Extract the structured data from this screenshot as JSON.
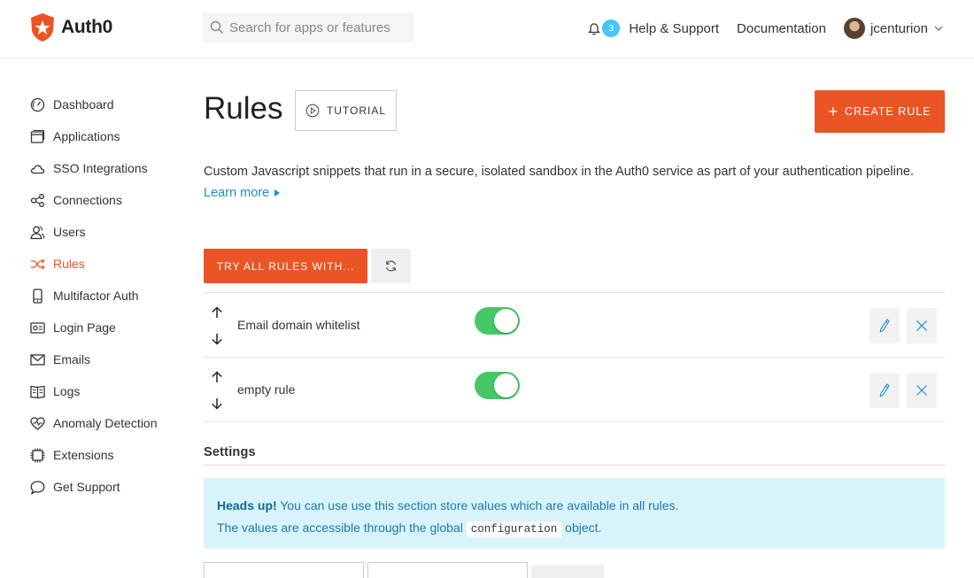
{
  "brand": {
    "name": "Auth0",
    "accent": "#eb5424"
  },
  "search": {
    "placeholder": "Search for apps or features"
  },
  "header": {
    "notifications_count": "3",
    "help_link": "Help & Support",
    "docs_link": "Documentation",
    "username": "jcenturion"
  },
  "sidebar": {
    "items": [
      {
        "label": "Dashboard",
        "icon": "dashboard-icon"
      },
      {
        "label": "Applications",
        "icon": "applications-icon"
      },
      {
        "label": "SSO Integrations",
        "icon": "cloud-icon"
      },
      {
        "label": "Connections",
        "icon": "connections-icon"
      },
      {
        "label": "Users",
        "icon": "users-icon"
      },
      {
        "label": "Rules",
        "icon": "shuffle-icon",
        "active": true
      },
      {
        "label": "Multifactor Auth",
        "icon": "phone-icon"
      },
      {
        "label": "Login Page",
        "icon": "login-page-icon"
      },
      {
        "label": "Emails",
        "icon": "mail-icon"
      },
      {
        "label": "Logs",
        "icon": "book-icon"
      },
      {
        "label": "Anomaly Detection",
        "icon": "heart-icon"
      },
      {
        "label": "Extensions",
        "icon": "chip-icon"
      },
      {
        "label": "Get Support",
        "icon": "chat-bubble-icon"
      }
    ]
  },
  "main": {
    "title": "Rules",
    "tutorial_label": "TUTORIAL",
    "create_label": "CREATE RULE",
    "description": "Custom Javascript snippets that run in a secure, isolated sandbox in the Auth0 service as part of your authentication pipeline.",
    "learn_more": "Learn more",
    "try_all_label": "TRY ALL RULES WITH...",
    "rules": [
      {
        "name": "Email domain whitelist",
        "enabled": true
      },
      {
        "name": "empty rule",
        "enabled": true
      }
    ],
    "settings": {
      "title": "Settings",
      "alert_heading": "Heads up!",
      "alert_line1": "You can use use this section store values which are available in all rules.",
      "alert_line2_pre": "The values are accessible through the global",
      "alert_code": "configuration",
      "alert_line2_post": "object."
    }
  }
}
